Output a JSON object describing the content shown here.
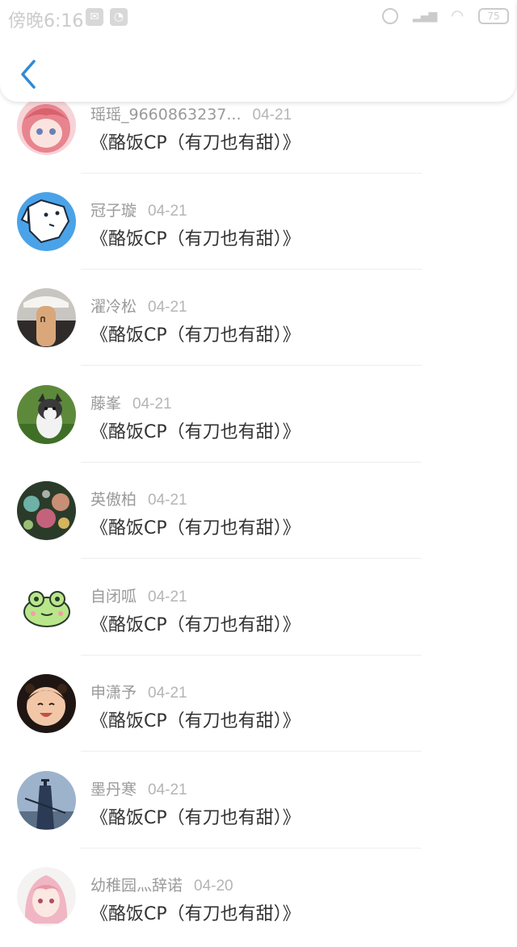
{
  "status_bar": {
    "time": "傍晚6:16",
    "battery": "75"
  },
  "header": {
    "back_icon": "chevron-left-icon",
    "accent": "#2d8bd8"
  },
  "items": [
    {
      "user": "瑶瑶_9660863237...",
      "date": "04-21",
      "title": "《酪饭CP（有刀也有甜）》",
      "avatar": "anime-pink-hair-avatar"
    },
    {
      "user": "冠子璇",
      "date": "04-21",
      "title": "《酪饭CP（有刀也有甜）》",
      "avatar": "white-dog-cartoon-avatar"
    },
    {
      "user": "濯冷松",
      "date": "04-21",
      "title": "《酪饭CP（有刀也有甜）》",
      "avatar": "finger-figure-avatar"
    },
    {
      "user": "藤峯",
      "date": "04-21",
      "title": "《酪饭CP（有刀也有甜）》",
      "avatar": "husky-puppy-avatar"
    },
    {
      "user": "英傲柏",
      "date": "04-21",
      "title": "《酪饭CP（有刀也有甜）》",
      "avatar": "flower-bubbles-avatar"
    },
    {
      "user": "自闭呱",
      "date": "04-21",
      "title": "《酪饭CP（有刀也有甜）》",
      "avatar": "green-frog-avatar"
    },
    {
      "user": "申潇予",
      "date": "04-21",
      "title": "《酪饭CP（有刀也有甜）》",
      "avatar": "smiling-child-avatar"
    },
    {
      "user": "墨丹寒",
      "date": "04-21",
      "title": "《酪饭CP（有刀也有甜）》",
      "avatar": "swordsman-silhouette-avatar"
    },
    {
      "user": "幼稚园灬辞诺",
      "date": "04-20",
      "title": "《酪饭CP（有刀也有甜）》",
      "avatar": "anime-girl-avatar"
    }
  ]
}
